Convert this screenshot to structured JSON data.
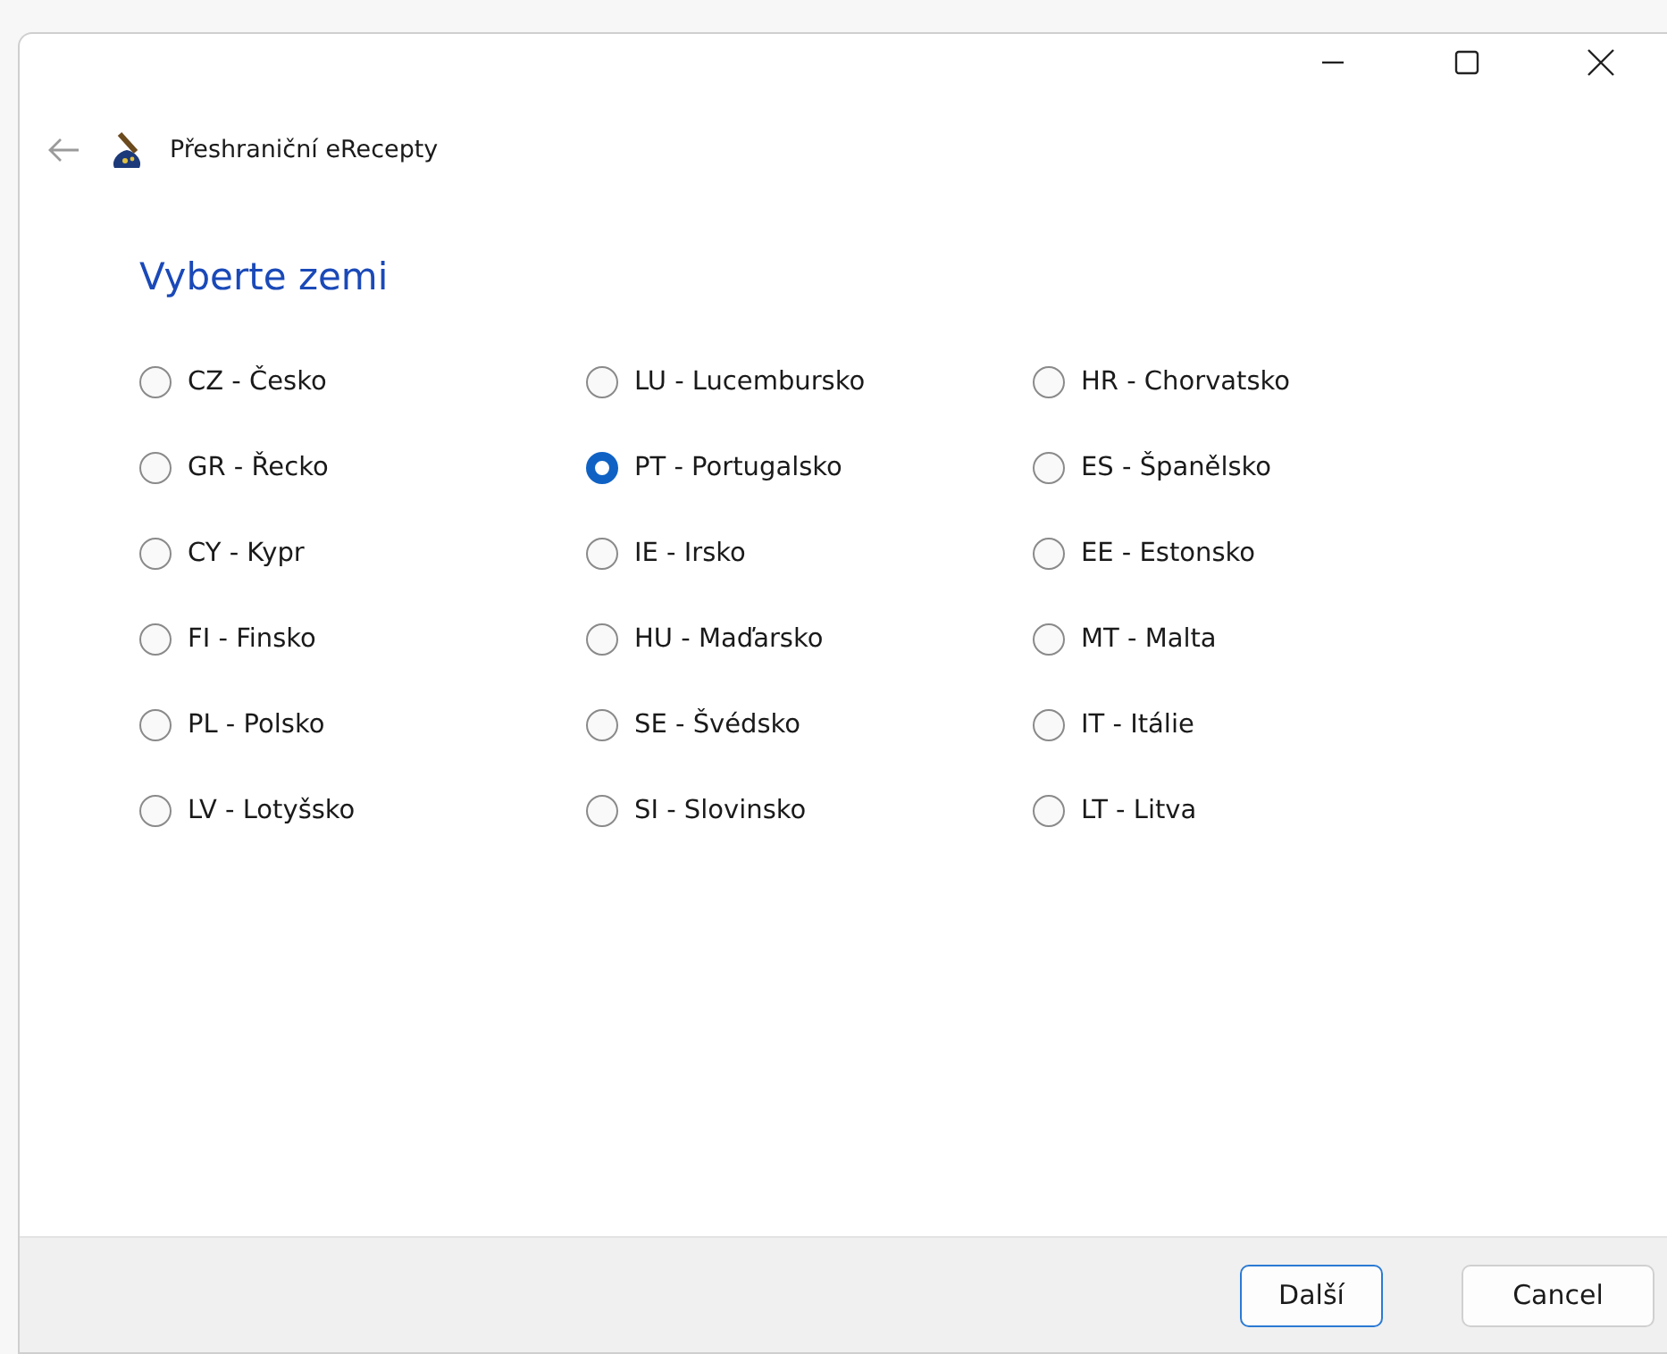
{
  "window": {
    "title": "Přeshraniční eRecepty"
  },
  "heading": "Vyberte zemi",
  "options": [
    {
      "label": "CZ - Česko",
      "selected": false
    },
    {
      "label": "LU - Lucembursko",
      "selected": false
    },
    {
      "label": "HR - Chorvatsko",
      "selected": false
    },
    {
      "label": "GR - Řecko",
      "selected": false
    },
    {
      "label": "PT - Portugalsko",
      "selected": true
    },
    {
      "label": "ES - Španělsko",
      "selected": false
    },
    {
      "label": "CY - Kypr",
      "selected": false
    },
    {
      "label": "IE - Irsko",
      "selected": false
    },
    {
      "label": "EE - Estonsko",
      "selected": false
    },
    {
      "label": "FI - Finsko",
      "selected": false
    },
    {
      "label": "HU - Maďarsko",
      "selected": false
    },
    {
      "label": "MT - Malta",
      "selected": false
    },
    {
      "label": "PL - Polsko",
      "selected": false
    },
    {
      "label": "SE - Švédsko",
      "selected": false
    },
    {
      "label": "IT - Itálie",
      "selected": false
    },
    {
      "label": "LV - Lotyšsko",
      "selected": false
    },
    {
      "label": "SI - Slovinsko",
      "selected": false
    },
    {
      "label": "LT - Litva",
      "selected": false
    }
  ],
  "buttons": [
    {
      "label": "Další",
      "kind": "primary"
    },
    {
      "label": "Cancel",
      "kind": "secondary"
    }
  ]
}
